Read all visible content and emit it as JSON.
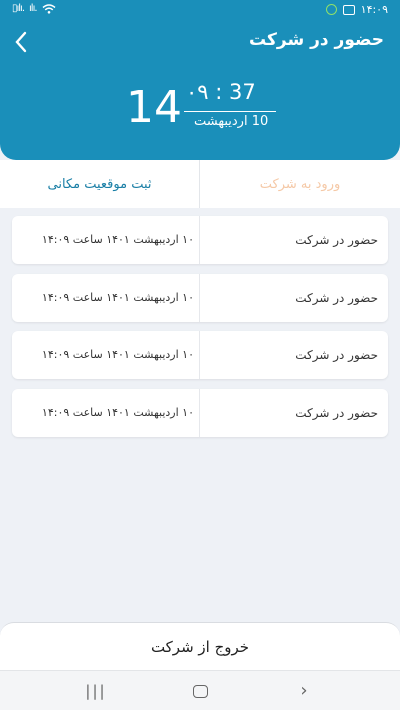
{
  "statusbar": {
    "time": "۱۴:۰۹",
    "left_icons": [
      "signal-icon",
      "signal-icon",
      "wifi-icon"
    ],
    "right_icons": [
      "image-icon",
      "check-circle-icon"
    ]
  },
  "header": {
    "title": "حضور در شرکت",
    "back_icon": "chevron-left-icon",
    "bg_color": "#1a8fba"
  },
  "clock": {
    "hour": "14",
    "minute_second": "۰۹ : 37",
    "date": "10 اردیبهشت"
  },
  "actions": {
    "left_label": "ثبت موقعیت مکانی",
    "right_label": "ورود به شرکت",
    "left_color": "#1a7fa6",
    "right_color": "#f5c9a7"
  },
  "records": [
    {
      "label": "حضور در شرکت",
      "time": "۱۰ اردیبهشت ۱۴۰۱ ساعت ۱۴:۰۹"
    },
    {
      "label": "حضور در شرکت",
      "time": "۱۰ اردیبهشت ۱۴۰۱ ساعت ۱۴:۰۹"
    },
    {
      "label": "حضور در شرکت",
      "time": "۱۰ اردیبهشت ۱۴۰۱ ساعت ۱۴:۰۹"
    },
    {
      "label": "حضور در شرکت",
      "time": "۱۰ اردیبهشت ۱۴۰۱ ساعت ۱۴:۰۹"
    }
  ],
  "exit_button": {
    "label": "خروج از شرکت"
  },
  "navbar": {
    "recent_icon": "|||",
    "home_icon": "home-icon",
    "back_icon": "›"
  }
}
